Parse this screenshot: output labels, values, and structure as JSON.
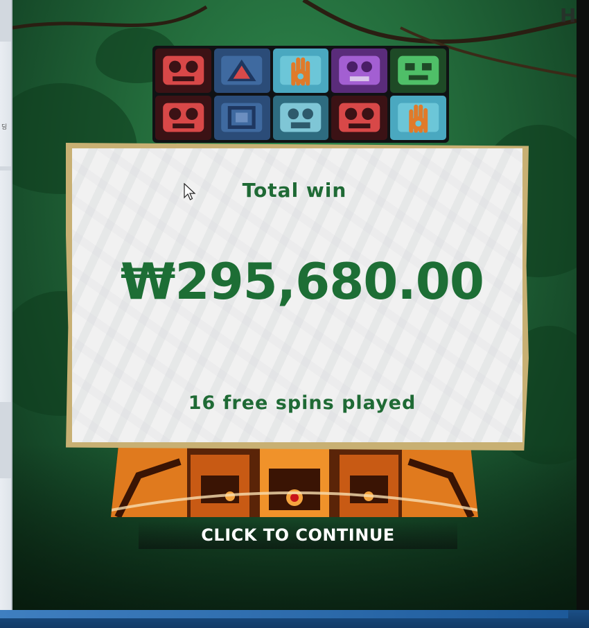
{
  "dialog": {
    "title": "Total win",
    "amount": "₩295,680.00",
    "spins_text": "16 free spins played"
  },
  "cta": {
    "label": "CLICK TO CONTINUE"
  },
  "browser_strip": {
    "glyph": "딩"
  },
  "symbols": {
    "row1": [
      "red-mask-icon",
      "blue-triangle-icon",
      "hand-spiral-icon",
      "purple-skull-mask-icon",
      "green-mask-icon"
    ],
    "row2": [
      "red-mask-icon",
      "blue-square-icon",
      "teal-mask-icon",
      "red-mask-icon",
      "hand-spiral-icon"
    ]
  },
  "colors": {
    "text_green": "#1f6a35",
    "jungle_green": "#236b3b",
    "panel_frame": "#c8b073"
  }
}
